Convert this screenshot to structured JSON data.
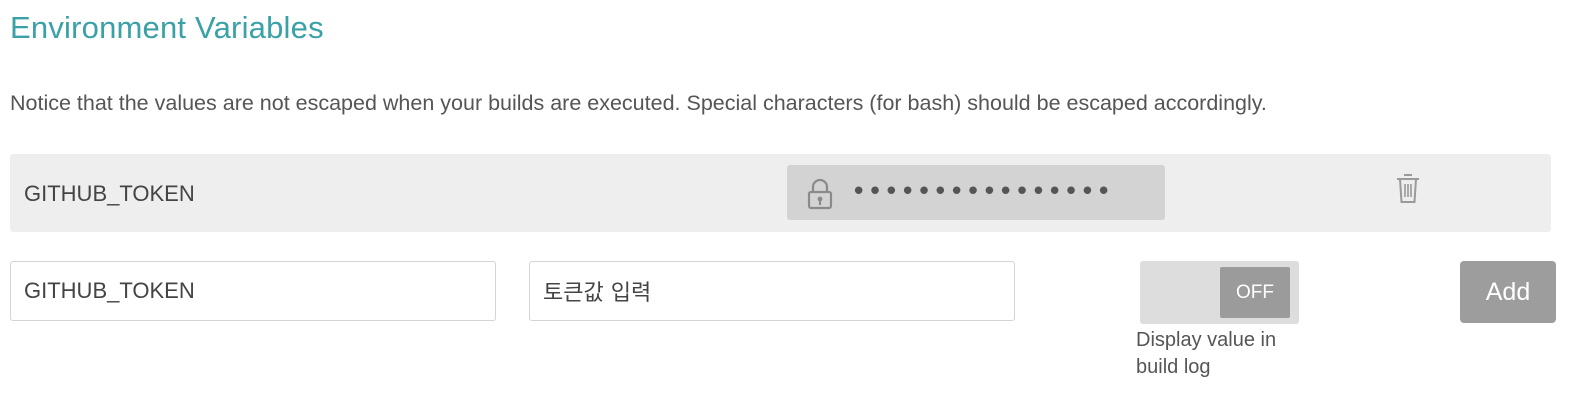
{
  "section": {
    "title": "Environment Variables",
    "notice": "Notice that the values are not escaped when your builds are executed. Special characters (for bash) should be escaped accordingly."
  },
  "existing_variables": [
    {
      "name": "GITHUB_TOKEN",
      "masked_value": "••••••••••••••••",
      "value_icon": "lock-icon",
      "delete_icon": "trash-icon"
    }
  ],
  "new_variable": {
    "name_value": "GITHUB_TOKEN",
    "value_value": "토큰값 입력",
    "display_toggle": {
      "state": "OFF",
      "caption": "Display value in build log"
    },
    "add_label": "Add"
  },
  "colors": {
    "title": "#3aa1a6",
    "row_background": "#eeeeee",
    "secret_background": "#d3d3d3",
    "button_gray": "#9d9d9d"
  }
}
